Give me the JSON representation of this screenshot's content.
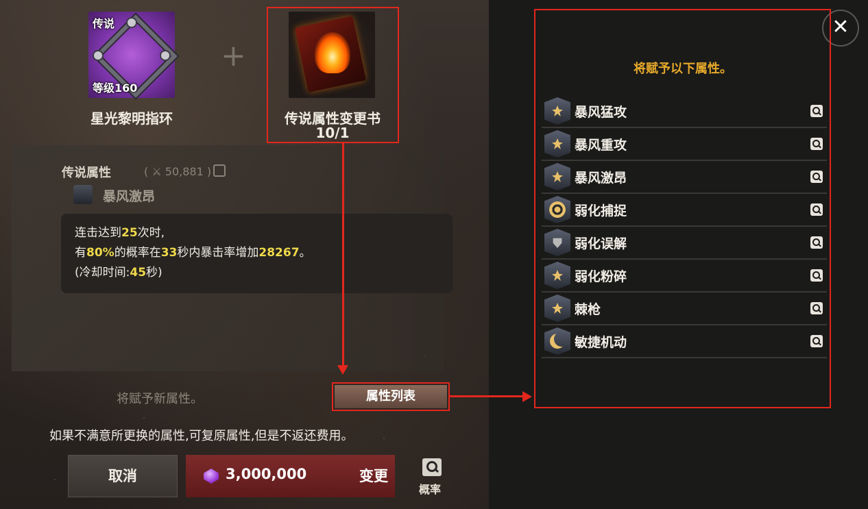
{
  "items": {
    "ring": {
      "tag": "传说",
      "level": "等级160",
      "name": "星光黎明指环"
    },
    "plus": "+",
    "book": {
      "name": "传说属性变更书",
      "count": "10/1"
    }
  },
  "current_attribute": {
    "heading": "传说属性",
    "power": "( ⚔ 50,881 )",
    "name": "暴风激昂",
    "description": {
      "line1_prefix": "连击达到",
      "line1_num": "25",
      "line1_suffix": "次时,",
      "line2_a": "有",
      "line2_b": "80%",
      "line2_c": "的概率在",
      "line2_d": "33",
      "line2_e": "秒内暴击率增加",
      "line2_f": "28267",
      "line2_g": "。",
      "line3_a": "(冷却时间:",
      "line3_b": "45",
      "line3_c": "秒)"
    }
  },
  "new_attribute_text": "将赋予新属性。",
  "attr_list_button": "属性列表",
  "notice": "如果不满意所更换的属性,可复原属性,但是不返还费用。",
  "cancel_button": "取消",
  "change_button": {
    "cost": "3,000,000",
    "label": "变更",
    "currency_icon": "purple-gem-icon"
  },
  "probability": {
    "label": "概率",
    "icon": "search-icon"
  },
  "panel": {
    "title": "将赋予以下属性。",
    "close": "✕",
    "attributes": [
      {
        "name": "暴风猛攻",
        "icon": "crossed-swords-icon"
      },
      {
        "name": "暴风重攻",
        "icon": "lightning-icon"
      },
      {
        "name": "暴风激昂",
        "icon": "lightning-icon"
      },
      {
        "name": "弱化捕捉",
        "icon": "target-icon"
      },
      {
        "name": "弱化误解",
        "icon": "shield-icon"
      },
      {
        "name": "弱化粉碎",
        "icon": "chevron-icon"
      },
      {
        "name": "棘枪",
        "icon": "spear-icon"
      },
      {
        "name": "敏捷机动",
        "icon": "moon-icon"
      }
    ]
  },
  "colors": {
    "accent_gold": "#e6a92a",
    "highlight_yellow": "#f0d94a",
    "annotation_red": "#e3271d",
    "change_button_red": "#7e2a2a"
  }
}
